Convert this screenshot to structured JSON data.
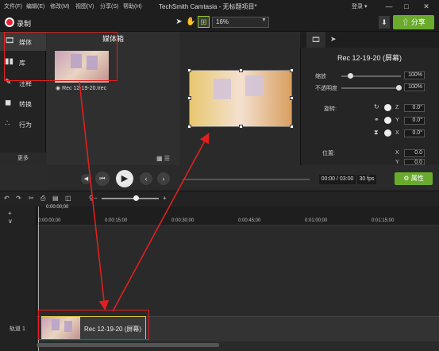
{
  "app": {
    "title": "TechSmith Camtasia - 无标题项目*",
    "login": "登录 ▾",
    "menu": [
      "文件(F)",
      "编辑(E)",
      "修改(M)",
      "视图(V)",
      "分享(S)",
      "帮助(H)"
    ]
  },
  "toolbar": {
    "record_label": "录制",
    "zoom_value": "16%",
    "share_label": "分享"
  },
  "sidebar": {
    "items": [
      {
        "label": "媒体",
        "icon": "film-icon"
      },
      {
        "label": "库",
        "icon": "library-icon"
      },
      {
        "label": "注释",
        "icon": "annotation-icon"
      },
      {
        "label": "转换",
        "icon": "transition-icon"
      },
      {
        "label": "行为",
        "icon": "behavior-icon"
      }
    ],
    "more_label": "更多"
  },
  "media_bin": {
    "title": "媒体箱",
    "item_label": "Rec 12-19-20.trec"
  },
  "properties": {
    "title": "Rec 12-19-20 (屏幕)",
    "scale_label": "缩放",
    "scale_value": "100%",
    "opacity_label": "不透明度",
    "opacity_value": "100%",
    "rotation_label": "旋转:",
    "rot_z": "0.0°",
    "rot_y": "0.0°",
    "rot_x": "0.0°",
    "position_label": "位置:",
    "pos_x": "0.0",
    "pos_y": "0.0",
    "axis_z": "Z",
    "axis_y": "Y",
    "axis_x": "X",
    "axis_x2": "X",
    "axis_y2": "Y"
  },
  "player": {
    "time": "00:00 / 03:00",
    "fps": "30 fps",
    "properties_label": "属性"
  },
  "timeline": {
    "playhead": "0:00:00;00",
    "ticks": [
      "0:00:00;00",
      "0:00:15;00",
      "0:00:30;00",
      "0:00:45;00",
      "0:01:00;00",
      "0:01:15;00"
    ],
    "track_label": "轨道 1",
    "clip_label": "Rec 12-19-20 (屏幕)"
  },
  "colors": {
    "accent": "#6aab2e",
    "annotation": "#e02020",
    "clip_border": "#d9c544"
  }
}
